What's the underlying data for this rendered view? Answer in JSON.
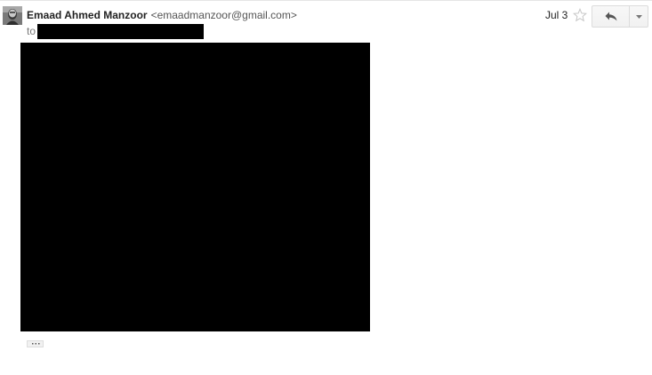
{
  "message": {
    "sender_name": "Emaad Ahmed Manzoor",
    "sender_email": "<emaadmanzoor@gmail.com>",
    "to_label": "to",
    "date": "Jul 3"
  },
  "icons": {
    "avatar": "avatar-photo",
    "star": "star-outline-icon",
    "reply": "reply-arrow-icon",
    "more": "chevron-down-icon",
    "trimmed": "ellipsis-icon"
  },
  "colors": {
    "redaction": "#000000",
    "star_outline": "#c6c6c6",
    "button_border": "#dcdcdc",
    "secondary_text": "#555555"
  }
}
